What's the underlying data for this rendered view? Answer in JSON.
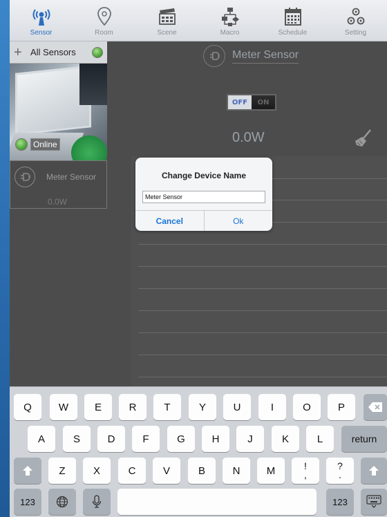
{
  "tabs": [
    {
      "label": "Sensor",
      "icon": "wireless-sensor-icon",
      "active": true
    },
    {
      "label": "Room",
      "icon": "map-pin-icon",
      "active": false
    },
    {
      "label": "Scene",
      "icon": "clapperboard-icon",
      "active": false
    },
    {
      "label": "Macro",
      "icon": "flowchart-icon",
      "active": false
    },
    {
      "label": "Schedule",
      "icon": "calendar-icon",
      "active": false
    },
    {
      "label": "Setting",
      "icon": "gears-icon",
      "active": false
    }
  ],
  "sidebar": {
    "all_sensors_label": "All Sensors",
    "camera_status": "Online",
    "sensor_card": {
      "name": "Meter Sensor",
      "value": "0.0W"
    }
  },
  "main": {
    "device_title": "Meter Sensor",
    "toggle_off": "OFF",
    "toggle_on": "ON",
    "power_reading": "0.0W"
  },
  "dialog": {
    "title": "Change Device Name",
    "input_value": "Meter Sensor",
    "cancel_label": "Cancel",
    "ok_label": "Ok"
  },
  "keyboard": {
    "row1": [
      "Q",
      "W",
      "E",
      "R",
      "T",
      "Y",
      "U",
      "I",
      "O",
      "P"
    ],
    "row2": [
      "A",
      "S",
      "D",
      "F",
      "G",
      "H",
      "J",
      "K",
      "L"
    ],
    "row3": [
      "Z",
      "X",
      "C",
      "V",
      "B",
      "N",
      "M"
    ],
    "punct1_top": "!",
    "punct1_bottom": ",",
    "punct2_top": "?",
    "punct2_bottom": ".",
    "return_label": "return",
    "numbers_label": "123",
    "numbers_label_right": "123"
  },
  "colors": {
    "accent": "#2d6dbf",
    "dialog_button": "#1a74d6",
    "status_green": "#4fa63b"
  }
}
